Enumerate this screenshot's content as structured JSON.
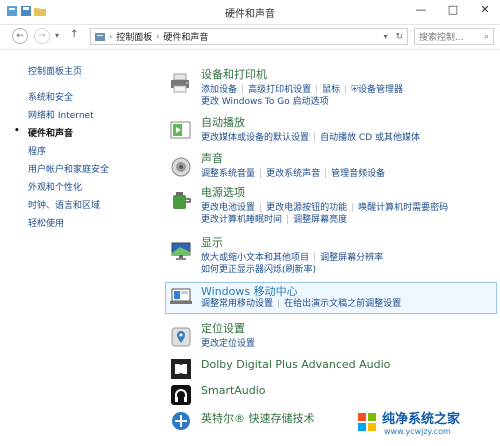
{
  "window": {
    "title": "硬件和声音",
    "buttons": {
      "minimize": "—",
      "maximize": "□",
      "close": "✕"
    }
  },
  "nav": {
    "back": "←",
    "forward": "→",
    "up": "↑"
  },
  "address": {
    "segments": [
      "控制面板",
      "硬件和声音"
    ],
    "refresh": "↻"
  },
  "search": {
    "placeholder": "搜索控制..."
  },
  "sidebar": {
    "items": [
      {
        "label": "控制面板主页"
      },
      {
        "label": "系统和安全"
      },
      {
        "label": "网络和 Internet"
      },
      {
        "label": "硬件和声音",
        "active": true
      },
      {
        "label": "程序"
      },
      {
        "label": "用户帐户和家庭安全"
      },
      {
        "label": "外观和个性化"
      },
      {
        "label": "时钟、语言和区域"
      },
      {
        "label": "轻松使用"
      }
    ]
  },
  "categories": [
    {
      "title": "设备和打印机",
      "links": [
        [
          "添加设备",
          "高级打印机设置",
          "鼠标",
          "设备管理器"
        ],
        [
          "更改 Windows To Go 启动选项"
        ]
      ]
    },
    {
      "title": "自动播放",
      "links": [
        [
          "更改媒体或设备的默认设置",
          "自动播放 CD 或其他媒体"
        ]
      ]
    },
    {
      "title": "声音",
      "links": [
        [
          "调整系统音量",
          "更改系统声音",
          "管理音频设备"
        ]
      ]
    },
    {
      "title": "电源选项",
      "links": [
        [
          "更改电池设置",
          "更改电源按钮的功能",
          "唤醒计算机时需要密码"
        ],
        [
          "更改计算机睡眠时间",
          "调整屏幕亮度"
        ]
      ]
    },
    {
      "title": "显示",
      "links": [
        [
          "放大或缩小文本和其他项目",
          "调整屏幕分辨率"
        ],
        [
          "如何更正显示器闪烁(刷新率)"
        ]
      ]
    },
    {
      "title": "Windows 移动中心",
      "links": [
        [
          "调整常用移动设置",
          "在给出演示文稿之前调整设置"
        ]
      ],
      "highlight": true
    },
    {
      "title": "定位设置",
      "links": [
        [
          "更改定位设置"
        ]
      ]
    },
    {
      "title": "Dolby Digital Plus Advanced Audio",
      "links": []
    },
    {
      "title": "SmartAudio",
      "links": []
    },
    {
      "title": "英特尔® 快速存储技术",
      "links": []
    }
  ],
  "watermark": {
    "text": "纯净系统之家",
    "sub": "www.ycwjzy.com"
  },
  "colors": {
    "link": "#1f4e8a",
    "category_title": "#2f6f3f",
    "highlight_bg": "#eef7ff",
    "highlight_border": "#99c7e6"
  }
}
